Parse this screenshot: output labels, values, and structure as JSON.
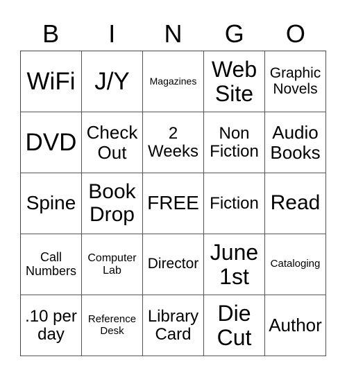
{
  "header": [
    "B",
    "I",
    "N",
    "G",
    "O"
  ],
  "cells": [
    [
      "WiFi",
      "J/Y",
      "Magazines",
      "Web\nSite",
      "Graphic\nNovels"
    ],
    [
      "DVD",
      "Check\nOut",
      "2\nWeeks",
      "Non\nFiction",
      "Audio\nBooks"
    ],
    [
      "Spine",
      "Book\nDrop",
      "FREE",
      "Fiction",
      "Read"
    ],
    [
      "Call\nNumbers",
      "Computer\nLab",
      "Director",
      "June\n1st",
      "Cataloging"
    ],
    [
      ".10 per\nday",
      "Reference\nDesk",
      "Library\nCard",
      "Die\nCut",
      "Author"
    ]
  ]
}
